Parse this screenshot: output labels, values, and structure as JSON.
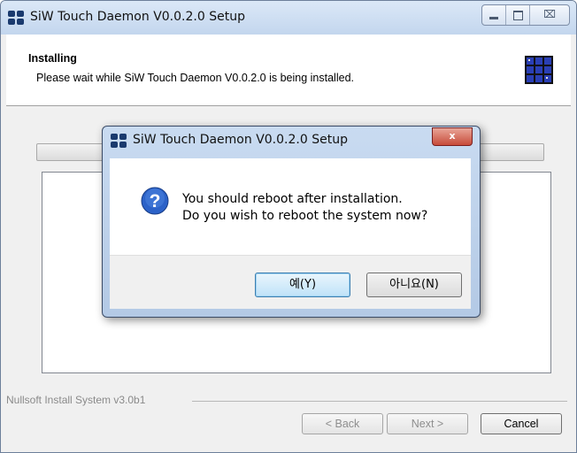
{
  "window": {
    "title": "SiW Touch Daemon V0.0.2.0 Setup",
    "icon": "installer-icon",
    "controls": {
      "minimize": "minimize-icon",
      "maximize": "maximize-icon",
      "close_glyph": "⌧"
    }
  },
  "header": {
    "title": "Installing",
    "subtitle": "Please wait while SiW Touch Daemon V0.0.2.0 is being installed."
  },
  "progress": {
    "value": 0
  },
  "footer": {
    "brand": "Nullsoft Install System v3.0b1",
    "back_label": "< Back",
    "next_label": "Next >",
    "cancel_label": "Cancel"
  },
  "dialog": {
    "title": "SiW Touch Daemon V0.0.2.0 Setup",
    "close_glyph": "x",
    "icon": "question-icon",
    "message_line1": "You should reboot after installation.",
    "message_line2": "Do you wish to reboot the system now?",
    "yes_label": "예(Y)",
    "no_label": "아니요(N)"
  },
  "colors": {
    "titlebar": "#c3d6ee",
    "dialog_frame": "#b3c9e5",
    "close_button": "#c74b3a",
    "default_button": "#bfe2f8"
  }
}
